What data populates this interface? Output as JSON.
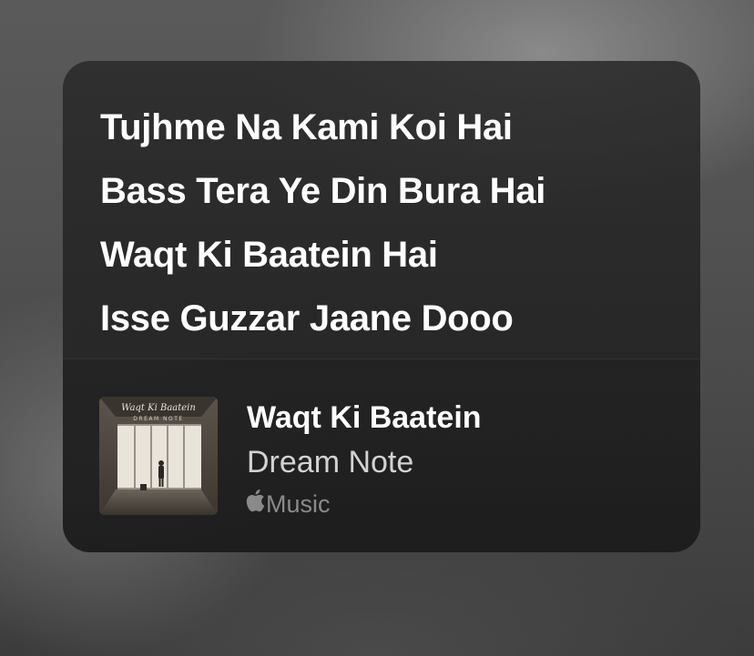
{
  "lyrics": {
    "lines": [
      "Tujhme Na Kami Koi Hai",
      "Bass Tera Ye Din Bura Hai",
      "Waqt Ki Baatein Hai",
      "Isse Guzzar Jaane Dooo"
    ]
  },
  "track": {
    "title": "Waqt Ki Baatein",
    "artist": "Dream Note",
    "artwork": {
      "title_text": "Waqt Ki Baatein",
      "subtitle_text": "DREAM NOTE",
      "icon": "album-artwork"
    }
  },
  "service": {
    "label": "Music",
    "icon": "apple-logo-icon"
  },
  "colors": {
    "card_background": "#262626",
    "text_primary": "#ffffff",
    "text_secondary": "#d2d2d2",
    "text_tertiary": "#8a8a8a"
  }
}
